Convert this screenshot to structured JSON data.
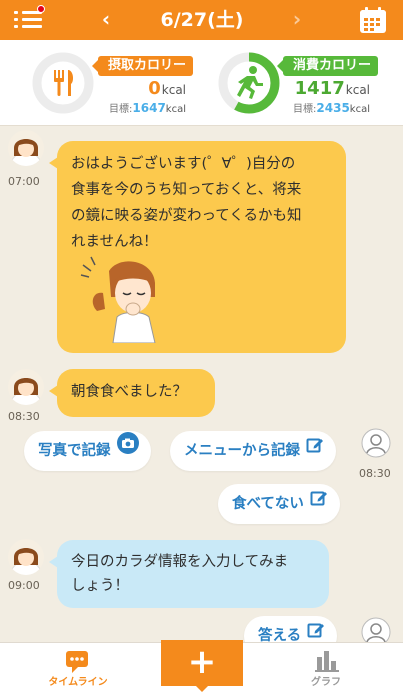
{
  "header": {
    "date": "6/27(土)",
    "prev_label": "‹",
    "next_label": "›"
  },
  "calories": {
    "intake": {
      "tag": "摂取カロリー",
      "value": "0",
      "unit": "kcal",
      "goal_label": "目標:",
      "goal_value": "1647",
      "goal_unit": "kcal",
      "fraction": 0
    },
    "burn": {
      "tag": "消費カロリー",
      "value": "1417",
      "unit": "kcal",
      "goal_label": "目標:",
      "goal_value": "2435",
      "goal_unit": "kcal",
      "fraction": 0.58
    }
  },
  "timeline": {
    "msg1": {
      "time": "07:00",
      "lines": [
        "おはようございます(゜∀゜)自分の",
        "食事を今のうち知っておくと、将来",
        "の鏡に映る姿が変わってくるかも知",
        "れませんね！"
      ]
    },
    "msg2": {
      "time": "08:30",
      "text": "朝食食べました？"
    },
    "replies1": {
      "time": "08:30",
      "photo": "写真で記録",
      "menu": "メニューから記録",
      "not_eaten": "食べてない"
    },
    "msg3": {
      "time": "09:00",
      "lines": [
        "今日のカラダ情報を入力してみま",
        "しょう！"
      ]
    },
    "replies2": {
      "answer": "答える"
    }
  },
  "footer": {
    "timeline_label": "タイムライン",
    "add_label": "+",
    "graph_label": "グラフ"
  },
  "colors": {
    "accent": "#f48a1c",
    "green": "#57b93a",
    "blue_text": "#2a7fc2",
    "bubble_yellow": "#fcc94d",
    "bubble_blue": "#c9e9f7"
  }
}
